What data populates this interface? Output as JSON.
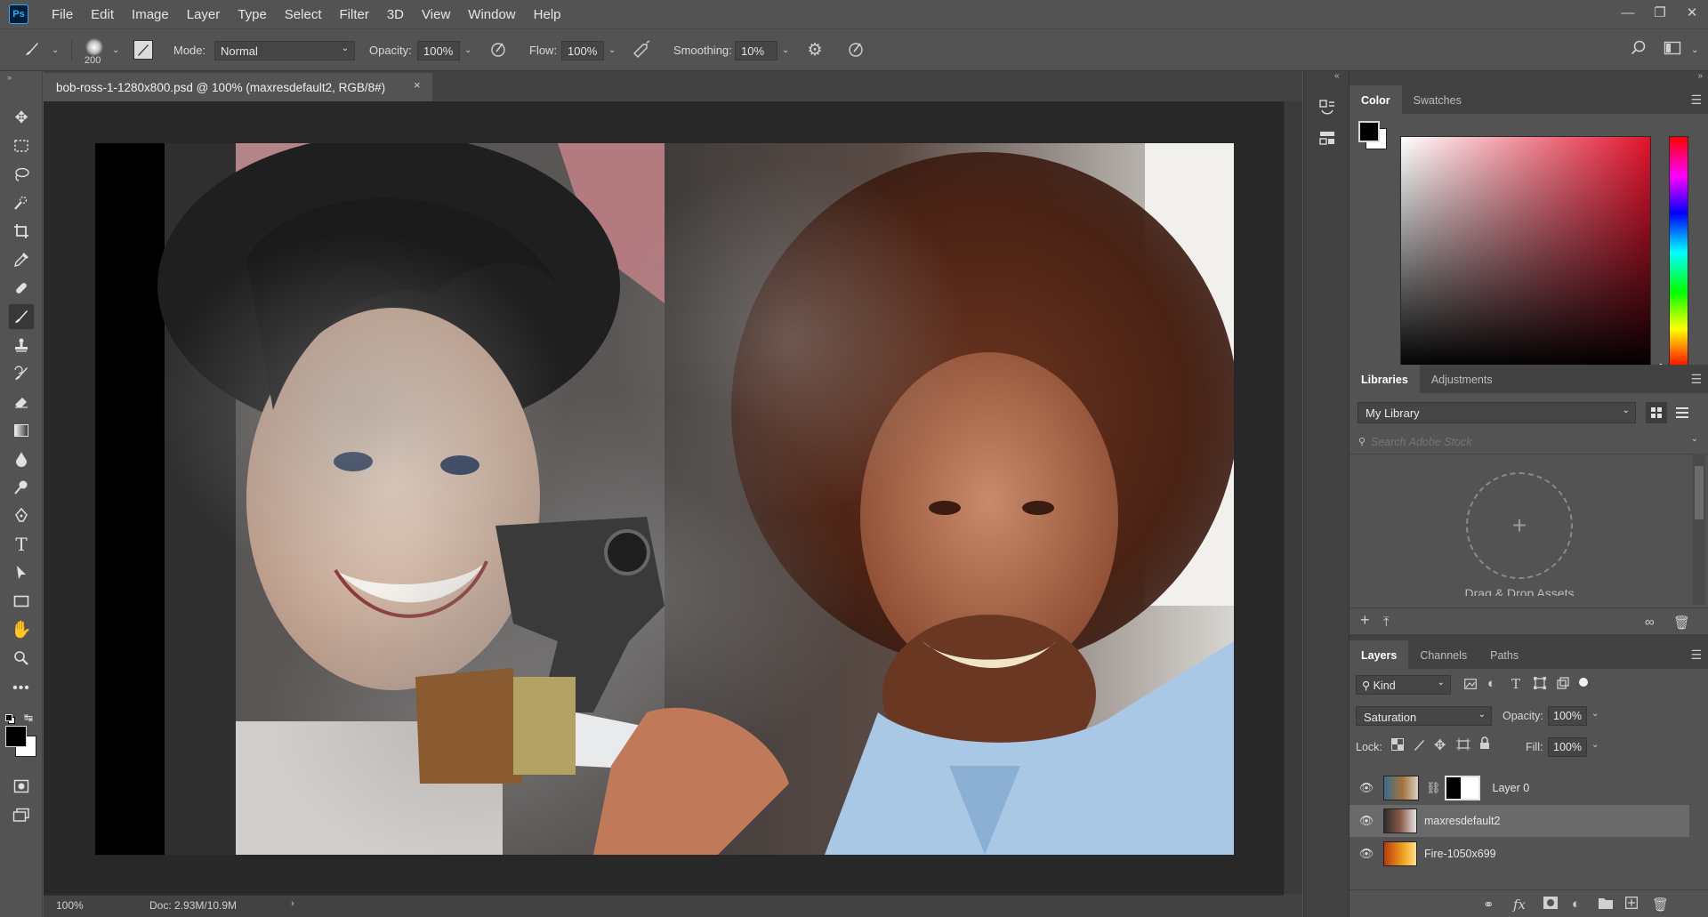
{
  "app": {
    "logo": "Ps"
  },
  "menu": [
    "File",
    "Edit",
    "Image",
    "Layer",
    "Type",
    "Select",
    "Filter",
    "3D",
    "View",
    "Window",
    "Help"
  ],
  "options_bar": {
    "brush_size": "200",
    "mode_label": "Mode:",
    "mode_value": "Normal",
    "opacity_label": "Opacity:",
    "opacity_value": "100%",
    "flow_label": "Flow:",
    "flow_value": "100%",
    "smoothing_label": "Smoothing:",
    "smoothing_value": "10%"
  },
  "document": {
    "tab_title": "bob-ross-1-1280x800.psd @ 100% (maxresdefault2, RGB/8#)",
    "zoom": "100%",
    "doc_info": "Doc: 2.93M/10.9M"
  },
  "color_panel": {
    "tabs": [
      "Color",
      "Swatches"
    ],
    "foreground": "#000000",
    "background": "#ffffff"
  },
  "libraries_panel": {
    "tabs": [
      "Libraries",
      "Adjustments"
    ],
    "library_name": "My Library",
    "search_placeholder": "Search Adobe Stock",
    "drop_text": "Drag & Drop Assets"
  },
  "layers_panel": {
    "tabs": [
      "Layers",
      "Channels",
      "Paths"
    ],
    "filter_kind": "Kind",
    "blend_mode": "Saturation",
    "opacity_label": "Opacity:",
    "opacity_value": "100%",
    "lock_label": "Lock:",
    "fill_label": "Fill:",
    "fill_value": "100%",
    "layers": [
      {
        "name": "Layer 0",
        "visible": true,
        "selected": false
      },
      {
        "name": "maxresdefault2",
        "visible": true,
        "selected": true
      },
      {
        "name": "Fire-1050x699",
        "visible": true,
        "selected": false
      }
    ]
  }
}
